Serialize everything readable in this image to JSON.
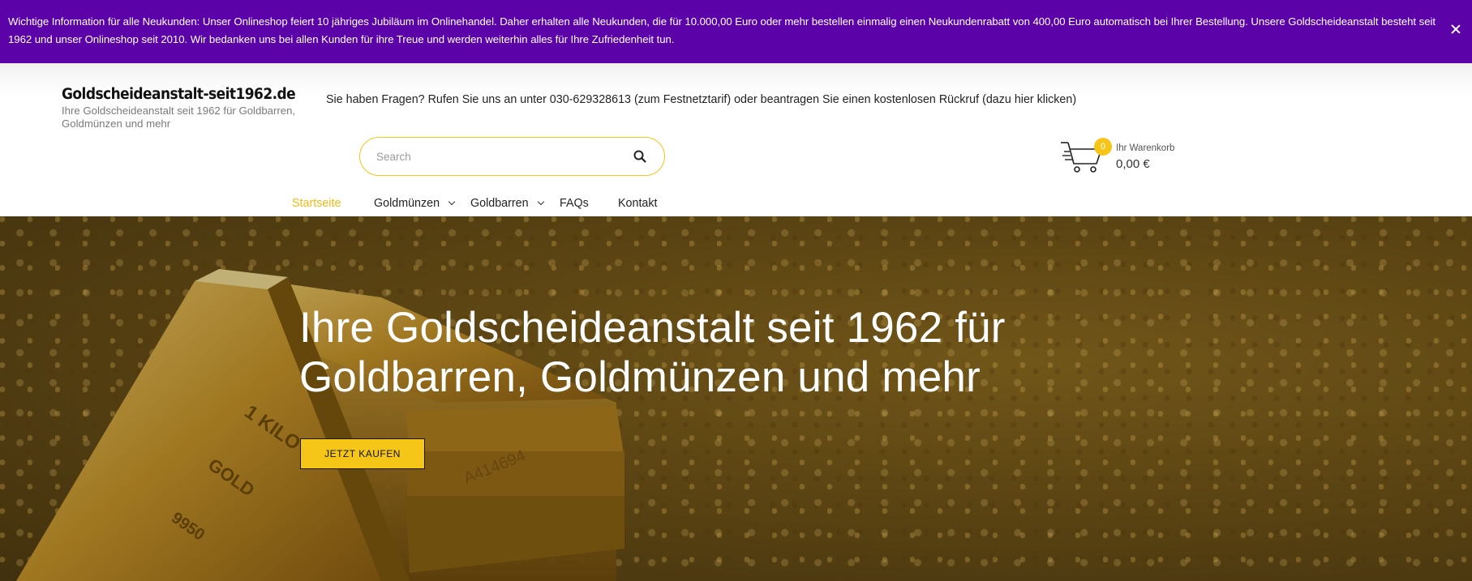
{
  "notice": {
    "text": "Wichtige Information für alle Neukunden: Unser Onlineshop feiert 10 jähriges Jubiläum im Onlinehandel. Daher erhalten alle Neukunden, die für 10.000,00 Euro oder mehr bestellen einmalig einen Neukundenrabatt von 400,00 Euro automatisch bei Ihrer Bestellung. Unsere Goldscheideanstalt besteht seit 1962 und unser Onlineshop seit 2010. Wir bedanken uns bei allen Kunden für ihre Treue und werden weiterhin alles für Ihre Zufriedenheit tun.",
    "background": "#5b02a8"
  },
  "header": {
    "logo_title": "Goldscheideanstalt-seit1962.de",
    "logo_tagline": "Ihre Goldscheideanstalt seit 1962 für Goldbarren, Goldmünzen und mehr",
    "contact_line": "Sie haben Fragen? Rufen Sie uns an unter 030-629328613 (zum Festnetztarif) oder beantragen Sie einen kostenlosen Rückruf (dazu hier klicken)"
  },
  "search": {
    "placeholder": "Search",
    "value": ""
  },
  "cart": {
    "count": "0",
    "label": "Ihr Warenkorb",
    "total": "0,00 €"
  },
  "nav": {
    "items": [
      {
        "label": "Startseite",
        "active": true
      },
      {
        "label": "Goldmünzen",
        "dropdown": true
      },
      {
        "label": "Goldbarren",
        "dropdown": true
      },
      {
        "label": "FAQs"
      },
      {
        "label": "Kontakt"
      }
    ]
  },
  "hero": {
    "title": "Ihre Goldscheideanstalt seit 1962 für Goldbarren, Goldmünzen und mehr",
    "button_label": "JETZT KAUFEN",
    "bar_engravings": [
      "1 KILO",
      "GOLD",
      "9950",
      "A414694"
    ]
  },
  "colors": {
    "accent": "#f5c518",
    "banner": "#5b02a8",
    "text": "#222222"
  }
}
